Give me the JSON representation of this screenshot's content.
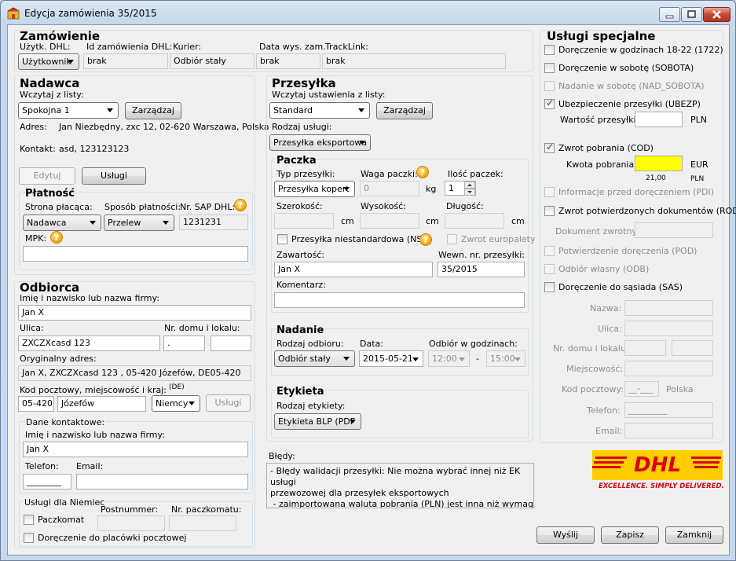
{
  "window": {
    "title": "Edycja zamówienia 35/2015"
  },
  "zamowienie": {
    "heading": "Zamówienie",
    "uzytk_label": "Użytk. DHL:",
    "uzytk_value": "Użytkownik",
    "id_label": "Id zamówienia DHL:",
    "id_value": "brak",
    "kurier_label": "Kurier:",
    "kurier_value": "Odbiór stały",
    "data_label": "Data wys. zam.",
    "data_value": "brak",
    "track_label": "TrackLink:",
    "track_value": "brak"
  },
  "nadawca": {
    "heading": "Nadawca",
    "wczytaj_label": "Wczytaj z listy:",
    "wczytaj_value": "Spokojna 1",
    "zarzadzaj": "Zarządzaj",
    "adres_label": "Adres:",
    "adres_value": "Jan Niezbędny, zxc 12, 02-620 Warszawa, Polska",
    "kontakt_label": "Kontakt:",
    "kontakt_value": "asd, 123123123",
    "edytuj": "Edytuj",
    "uslugi": "Usługi"
  },
  "platnosc": {
    "heading": "Płatność",
    "strona_label": "Strona płacąca:",
    "strona_value": "Nadawca",
    "sposob_label": "Sposób płatności:",
    "sposob_value": "Przelew",
    "sap_label": "Nr. SAP DHL:",
    "sap_value": "1231231",
    "mpk_label": "MPK:",
    "mpk_value": ""
  },
  "odbiorca": {
    "heading": "Odbiorca",
    "imie_label": "Imię i nazwisko lub nazwa firmy:",
    "imie_value": "Jan X",
    "ulica_label": "Ulica:",
    "ulica_value": "ZXCZXcasd 123",
    "nrdomu_label": "Nr. domu i lokalu:",
    "nrdomu_value": ".",
    "nrlokalu_value": "",
    "oryg_label": "Oryginalny adres:",
    "oryg_value": "Jan X, ZXCZXcasd 123 , 05-420 Józefów, DE05-420",
    "kod_label": "Kod pocztowy, miejscowość i kraj:",
    "kod_hint": "(DE)",
    "kod_value": "05-420",
    "miasto_value": "Józefów",
    "kraj_value": "Niemcy",
    "uslugi": "Usługi"
  },
  "dane_kontaktowe": {
    "heading": "Dane kontaktowe:",
    "imie_label": "Imię i nazwisko lub nazwa firmy:",
    "imie_value": "Jan X",
    "telefon_label": "Telefon:",
    "telefon_value": "________",
    "email_label": "Email:",
    "email_value": ""
  },
  "niemcy": {
    "heading": "Usługi dla Niemiec",
    "postnummer_label": "Postnummer:",
    "paczkomat_nr_label": "Nr. paczkomatu:",
    "paczkomat": "Paczkomat",
    "placowka": "Doręczenie do placówki pocztowej"
  },
  "przesylka": {
    "heading": "Przesyłka",
    "wczytaj_label": "Wczytaj ustawienia z listy:",
    "wczytaj_value": "Standard",
    "zarzadzaj": "Zarządzaj",
    "rodzaj_label": "Rodzaj usługi:",
    "rodzaj_value": "Przesyłka eksportowa"
  },
  "paczka": {
    "heading": "Paczka",
    "typ_label": "Typ przesyłki:",
    "typ_value": "Przesyłka kopert",
    "waga_label": "Waga paczki:",
    "waga_value": "0",
    "waga_unit": "kg",
    "ilosc_label": "Ilość paczek:",
    "ilosc_value": "1",
    "szer_label": "Szerokość:",
    "wys_label": "Wysokość:",
    "dl_label": "Długość:",
    "cm": "cm",
    "nst_label": "Przesyłka niestandardowa (NST)",
    "europalety": "Zwrot europalety",
    "zawartosc_label": "Zawartość:",
    "zawartosc_value": "Jan X",
    "wewn_label": "Wewn. nr. przesyłki:",
    "wewn_value": "35/2015",
    "komentarz_label": "Komentarz:",
    "komentarz_value": ""
  },
  "nadanie": {
    "heading": "Nadanie",
    "rodzaj_label": "Rodzaj odbioru:",
    "rodzaj_value": "Odbiór stały",
    "data_label": "Data:",
    "data_value": "2015-05-21",
    "godz_label": "Odbiór w godzinach:",
    "od_value": "12:00",
    "dash": "-",
    "do_value": "15:00"
  },
  "etykieta": {
    "heading": "Etykieta",
    "rodzaj_label": "Rodzaj etykiety:",
    "rodzaj_value": "Etykieta BLP (PDF"
  },
  "bledy": {
    "label": "Błędy:",
    "lines": [
      "- Błędy walidacji przesyłki: Nie można wybrać innej niż EK usługi",
      "przewozowej dla przesyłek eksportowych",
      " - zaimportowana waluta pobrania (PLN) jest inna niż wymagana przez"
    ]
  },
  "uslugi_specjalne": {
    "heading": "Usługi specjalne",
    "dor1822": "Doręczenie w godzinach 18-22 (1722)",
    "sobota": "Doręczenie w sobotę (SOBOTA)",
    "nadanie_sobota": "Nadanie w sobotę (NAD_SOBOTA)",
    "ubezp": "Ubezpieczenie przesyłki (UBEZP)",
    "wartosc_label": "Wartość przesyłki:",
    "wartosc_value": "",
    "wartosc_unit": "PLN",
    "cod": "Zwrot pobrania (COD)",
    "kwota_label": "Kwota pobrania:",
    "kwota_value": "",
    "kwota_unit": "EUR",
    "kwota_orig": "21,00",
    "kwota_orig_unit": "PLN",
    "pdi": "Informacje przed doręczeniem (PDI)",
    "rod": "Zwrot potwierdzonych dokumentów (ROD)",
    "dok_label": "Dokument zwrotny:",
    "pod": "Potwierdzenie doręczenia (POD)",
    "odb": "Odbiór własny (ODB)",
    "sas": "Doręczenie do sąsiada (SAS)",
    "nazwa_label": "Nazwa:",
    "ulica_label": "Ulica:",
    "nrdomu_label": "Nr. domu i lokalu:",
    "miejsc_label": "Miejscowość:",
    "kod_label": "Kod pocztowy:",
    "kod_value": "__-___",
    "kraj_value": "Polska",
    "telefon_label": "Telefon:",
    "telefon_value": "_________",
    "email_label": "Email:"
  },
  "dhl": {
    "logo": "DHL",
    "tagline": "EXCELLENCE. SIMPLY DELIVERED.",
    "red": "#d40511",
    "yellow": "#ffcc00"
  },
  "footer": {
    "wyslij": "Wyślij",
    "zapisz": "Zapisz",
    "zamknij": "Zamknij"
  }
}
